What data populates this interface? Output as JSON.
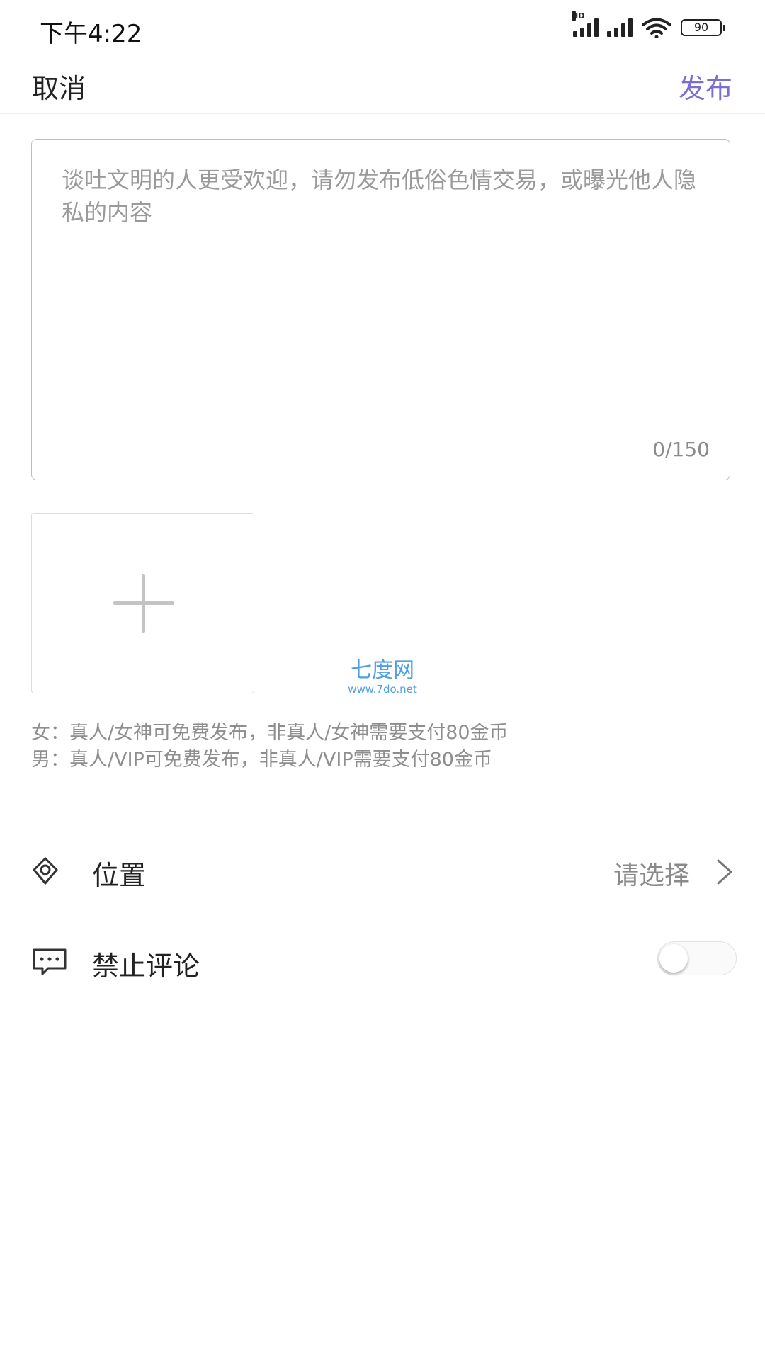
{
  "status_bar": {
    "time": "下午4:22",
    "network_tag": "HD",
    "battery": "90"
  },
  "nav": {
    "cancel_label": "取消",
    "publish_label": "发布"
  },
  "post": {
    "placeholder": "谈吐文明的人更受欢迎，请勿发布低俗色情交易，或曝光他人隐私的内容",
    "char_count": "0/150"
  },
  "watermark": {
    "name": "七度网",
    "url": "www.7do.net"
  },
  "notes": {
    "female": "女：真人/女神可免费发布，非真人/女神需要支付80金币",
    "male": "男：真人/VIP可免费发布，非真人/VIP需要支付80金币"
  },
  "location": {
    "label": "位置",
    "value": "请选择"
  },
  "comment": {
    "label": "禁止评论",
    "disabled": false
  },
  "colors": {
    "accent": "#7a6fd0",
    "watermark": "#4f9fe6"
  },
  "icons": {
    "location": "location-pin-icon",
    "comment": "chat-bubble-icon",
    "add_image": "plus-icon",
    "chevron": "chevron-right-icon"
  }
}
